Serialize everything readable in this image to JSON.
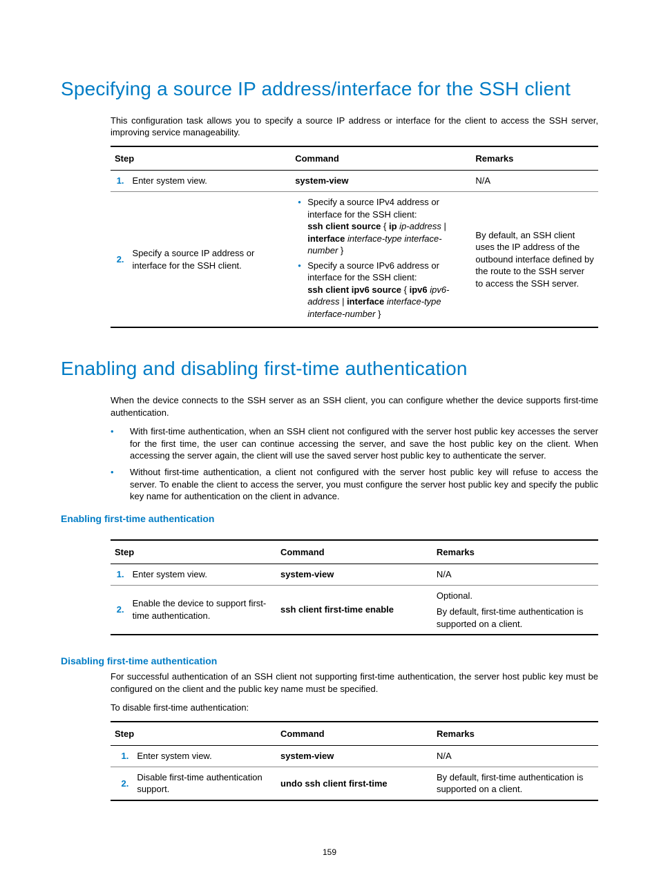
{
  "page_number": "159",
  "section1": {
    "heading": "Specifying a source IP address/interface for the SSH client",
    "intro": "This configuration task allows you to specify a source IP address or interface for the client to access the SSH server, improving service manageability.",
    "table": {
      "headers": {
        "step": "Step",
        "command": "Command",
        "remarks": "Remarks"
      },
      "rows": [
        {
          "num": "1.",
          "step": "Enter system view.",
          "command": "system-view",
          "remarks": "N/A"
        },
        {
          "num": "2.",
          "step": "Specify a source IP address or interface for the SSH client.",
          "bullet1": {
            "intro": "Specify a source IPv4 address or interface for the SSH client:",
            "cmd_prefix": "ssh client source",
            "cmd_mid1": " { ",
            "ip": "ip",
            "ip_var": " ip-address",
            "cmd_or": " | ",
            "iface": "interface",
            "iface_var": " interface-type interface-number",
            "cmd_end": " }"
          },
          "bullet2": {
            "intro": "Specify a source IPv6 address or interface for the SSH client:",
            "cmd_prefix": "ssh client ipv6 source",
            "cmd_mid1": " { ",
            "ipv6": "ipv6",
            "ipv6_var": " ipv6-address",
            "cmd_or": " | ",
            "iface": "interface",
            "iface_var": " interface-type interface-number",
            "cmd_end": " }"
          },
          "remarks": "By default, an SSH client uses the IP address of the outbound interface defined by the route to the SSH server to access the SSH server."
        }
      ]
    }
  },
  "section2": {
    "heading": "Enabling and disabling first-time authentication",
    "intro": "When the device connects to the SSH server as an SSH client, you can configure whether the device supports first-time authentication.",
    "bullet1": "With first-time authentication, when an SSH client not configured with the server host public key accesses the server for the first time, the user can continue accessing the server, and save the host public key on the client. When accessing the server again, the client will use the saved server host public key to authenticate the server.",
    "bullet2": "Without first-time authentication, a client not configured with the server host public key will refuse to access the server. To enable the client to access the server, you must configure the server host public key and specify the public key name for authentication on the client in advance.",
    "sub1": {
      "heading": "Enabling first-time authentication",
      "table": {
        "headers": {
          "step": "Step",
          "command": "Command",
          "remarks": "Remarks"
        },
        "rows": [
          {
            "num": "1.",
            "step": "Enter system view.",
            "command": "system-view",
            "remarks": "N/A"
          },
          {
            "num": "2.",
            "step": "Enable the device to support first-time authentication.",
            "command": "ssh client first-time enable",
            "remarks1": "Optional.",
            "remarks2": "By default, first-time authentication is supported on a client."
          }
        ]
      }
    },
    "sub2": {
      "heading": "Disabling first-time authentication",
      "para1": "For successful authentication of an SSH client not supporting first-time authentication, the server host public key must be configured on the client and the public key name must be specified.",
      "para2": "To disable first-time authentication:",
      "table": {
        "headers": {
          "step": "Step",
          "command": "Command",
          "remarks": "Remarks"
        },
        "rows": [
          {
            "num": "1.",
            "step": "Enter system view.",
            "command": "system-view",
            "remarks": "N/A"
          },
          {
            "num": "2.",
            "step": "Disable first-time authentication support.",
            "command": "undo ssh client first-time",
            "remarks": "By default, first-time authentication is supported on a client."
          }
        ]
      }
    }
  }
}
